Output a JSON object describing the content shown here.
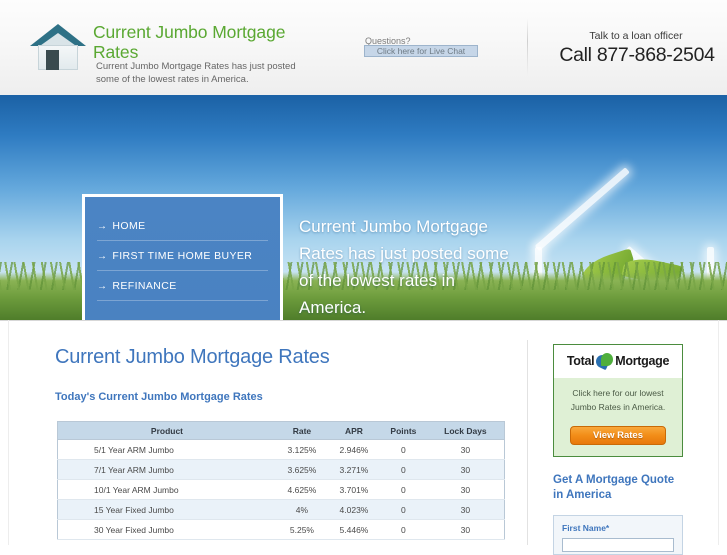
{
  "header": {
    "logo_icon": "house-icon",
    "site_title": "Current Jumbo Mortgage Rates",
    "tagline": "Current Jumbo Mortgage Rates has just posted some of the lowest rates in America.",
    "questions_label": "Questions?",
    "live_chat_label": "Click here for Live Chat",
    "talk_label": "Talk to a loan officer",
    "phone": "Call 877-868-2504"
  },
  "hero": {
    "nav_items": [
      {
        "arrow": "→",
        "label": "HOME"
      },
      {
        "arrow": "→",
        "label": "FIRST TIME HOME BUYER"
      },
      {
        "arrow": "→",
        "label": "REFINANCE"
      }
    ],
    "headline": "Current Jumbo Mortgage Rates has just posted some of the lowest rates in America.",
    "image_icons": [
      "house-outline-icon",
      "hand-holding-plant-icon",
      "grass-icon"
    ]
  },
  "main": {
    "heading": "Current Jumbo Mortgage Rates",
    "subheading": "Today's Current Jumbo Mortgage Rates",
    "table": {
      "columns": [
        "Product",
        "Rate",
        "APR",
        "Points",
        "Lock Days"
      ],
      "rows": [
        [
          "5/1 Year ARM Jumbo",
          "3.125%",
          "2.946%",
          "0",
          "30"
        ],
        [
          "7/1 Year ARM Jumbo",
          "3.625%",
          "3.271%",
          "0",
          "30"
        ],
        [
          "10/1 Year ARM Jumbo",
          "4.625%",
          "3.701%",
          "0",
          "30"
        ],
        [
          "15 Year Fixed Jumbo",
          "4%",
          "4.023%",
          "0",
          "30"
        ],
        [
          "30 Year Fixed Jumbo",
          "5.25%",
          "5.446%",
          "0",
          "30"
        ]
      ]
    }
  },
  "sidebar": {
    "widget": {
      "logo_word_1": "Total",
      "logo_word_2": "Mortgage",
      "logo_icon": "swirl-arrows-icon",
      "promo_text": "Click here for our lowest Jumbo Rates in America.",
      "button_label": "View Rates"
    },
    "quote_heading": "Get A Mortgage Quote in America",
    "form": {
      "first_name_label": "First Name*",
      "first_name_value": "",
      "first_name_placeholder": ""
    }
  },
  "colors": {
    "brand_green": "#5aa832",
    "link_blue": "#3f76bd",
    "nav_blue": "#4b84c4",
    "table_header": "#c5d8e8",
    "widget_green": "#dff0d5",
    "cta_orange": "#f28d18"
  }
}
